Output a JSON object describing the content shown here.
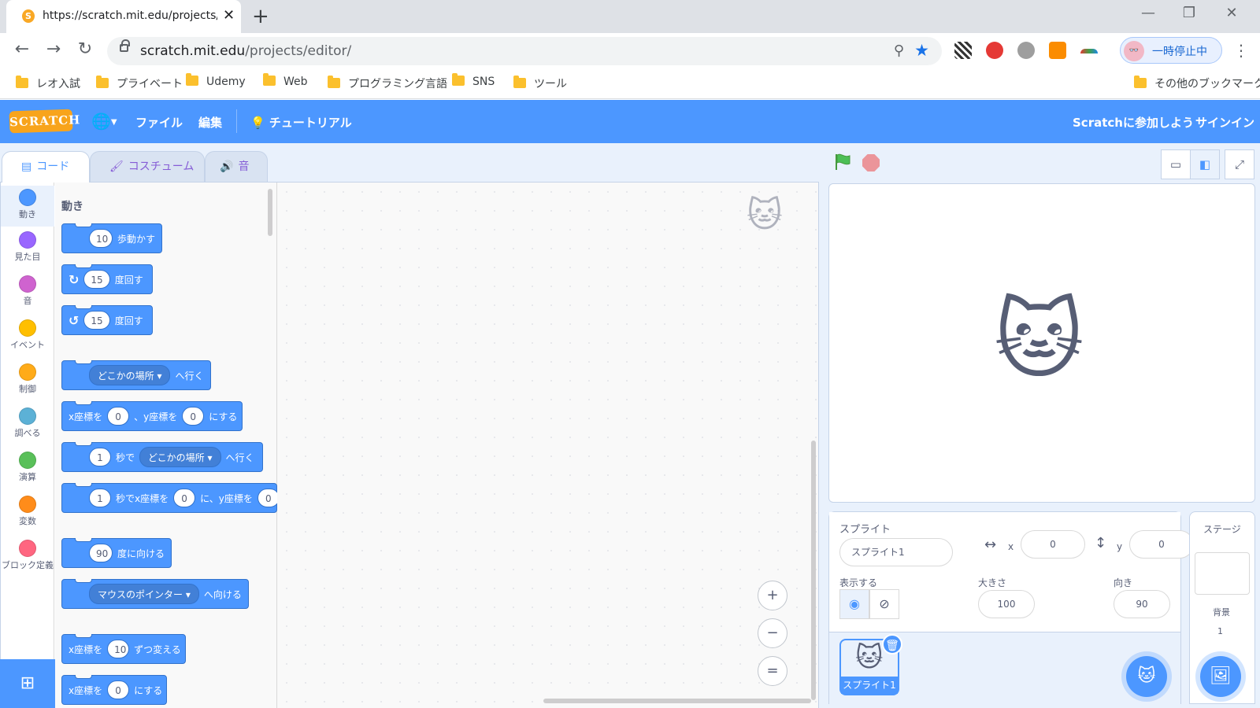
{
  "browser": {
    "tab_title": "https://scratch.mit.edu/projects/e",
    "url_host": "scratch.mit.edu",
    "url_path": "/projects/editor/",
    "profile_label": "一時停止中",
    "bookmarks": [
      "レオ入試",
      "プライベート",
      "Udemy",
      "Web",
      "プログラミング言語",
      "SNS",
      "ツール"
    ],
    "other_bookmarks": "その他のブックマーク"
  },
  "menubar": {
    "logo": "SCRATCH",
    "file": "ファイル",
    "edit": "編集",
    "tutorial": "チュートリアル",
    "join": "Scratchに参加しよう",
    "signin": "サインイン"
  },
  "tabs": {
    "code": "コード",
    "costume": "コスチューム",
    "sound": "音"
  },
  "categories": [
    {
      "label": "動き",
      "color": "#4c97ff"
    },
    {
      "label": "見た目",
      "color": "#9966ff"
    },
    {
      "label": "音",
      "color": "#cf63cf"
    },
    {
      "label": "イベント",
      "color": "#ffbf00"
    },
    {
      "label": "制御",
      "color": "#ffab19"
    },
    {
      "label": "調べる",
      "color": "#5cb1d6"
    },
    {
      "label": "演算",
      "color": "#59c059"
    },
    {
      "label": "変数",
      "color": "#ff8c1a"
    },
    {
      "label": "ブロック定義",
      "color": "#ff6680"
    }
  ],
  "palette": {
    "title": "動き",
    "b1": {
      "value": "10",
      "text": "歩動かす"
    },
    "b2": {
      "value": "15",
      "text": "度回す"
    },
    "b3": {
      "value": "15",
      "text": "度回す"
    },
    "b4": {
      "drop": "どこかの場所",
      "text": "へ行く"
    },
    "b5": {
      "t1": "x座標を",
      "v1": "0",
      "t2": "、y座標を",
      "v2": "0",
      "t3": "にする"
    },
    "b6": {
      "v1": "1",
      "t1": "秒で",
      "drop": "どこかの場所",
      "t2": "へ行く"
    },
    "b7": {
      "v1": "1",
      "t1": "秒でx座標を",
      "v2": "0",
      "t2": "に、y座標を",
      "v3": "0"
    },
    "b8": {
      "value": "90",
      "text": "度に向ける"
    },
    "b9": {
      "drop": "マウスのポインター",
      "text": "へ向ける"
    },
    "b10": {
      "t1": "x座標を",
      "value": "10",
      "t2": "ずつ変える"
    },
    "b11": {
      "t1": "x座標を",
      "value": "0",
      "t2": "にする"
    }
  },
  "zoom": {
    "in": "+",
    "out": "−",
    "reset": "="
  },
  "sprite": {
    "heading": "スプライト",
    "name": "スプライト1",
    "x_label": "x",
    "x": "0",
    "y_label": "y",
    "y": "0",
    "show_label": "表示する",
    "size_label": "大きさ",
    "size": "100",
    "direction_label": "向き",
    "direction": "90",
    "thumb_name": "スプライト1"
  },
  "stage_panel": {
    "heading": "ステージ",
    "backdrop_label": "背景",
    "backdrop_count": "1"
  }
}
